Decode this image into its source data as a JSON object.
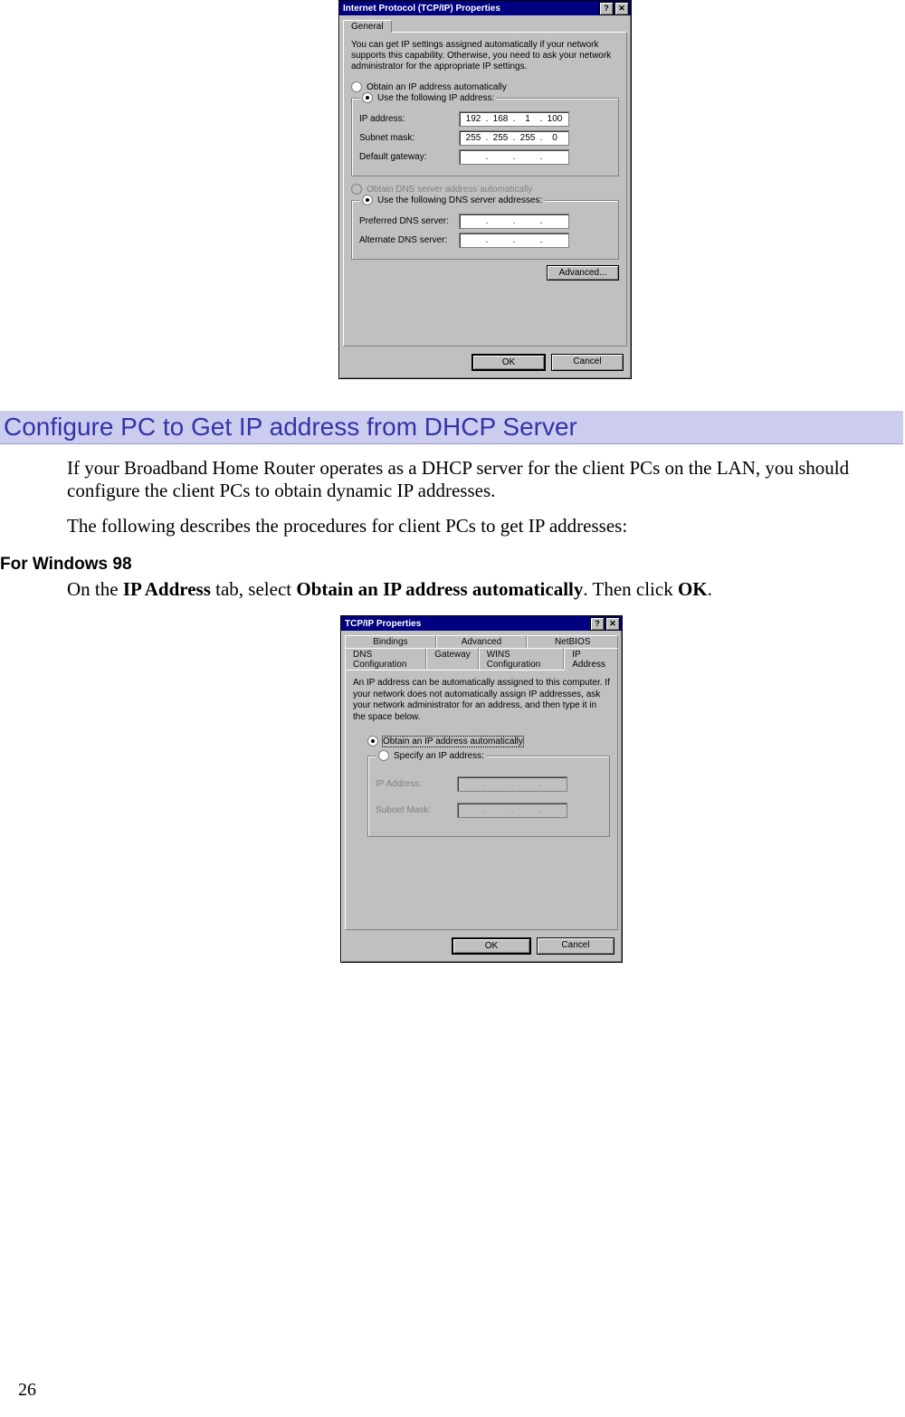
{
  "dialog_ip": {
    "title": "Internet Protocol (TCP/IP) Properties",
    "tab_general": "General",
    "intro": "You can get IP settings assigned automatically if your network supports this capability. Otherwise, you need to ask your network administrator for the appropriate IP settings.",
    "radio_obtain_ip": "Obtain an IP address automatically",
    "radio_use_ip": "Use the following IP address:",
    "lbl_ip": "IP address:",
    "lbl_subnet": "Subnet mask:",
    "lbl_gateway": "Default gateway:",
    "ip_oct": [
      "192",
      "168",
      "1",
      "100"
    ],
    "sm_oct": [
      "255",
      "255",
      "255",
      "0"
    ],
    "gw_oct": [
      "",
      "",
      "",
      ""
    ],
    "radio_obtain_dns": "Obtain DNS server address automatically",
    "radio_use_dns": "Use the following DNS server addresses:",
    "lbl_pref_dns": "Preferred DNS server:",
    "lbl_alt_dns": "Alternate DNS server:",
    "pdns_oct": [
      "",
      "",
      "",
      ""
    ],
    "adns_oct": [
      "",
      "",
      "",
      ""
    ],
    "btn_advanced": "Advanced...",
    "btn_ok": "OK",
    "btn_cancel": "Cancel",
    "help_glyph": "?",
    "close_glyph": "✕"
  },
  "section_heading": "Configure PC to Get IP address from DHCP Server",
  "para1": "If your Broadband Home Router operates as a DHCP server for the client PCs on the LAN, you should configure the client PCs to obtain dynamic IP addresses.",
  "para2": "The following describes the procedures for client PCs to get IP addresses:",
  "win98_heading": "For Windows 98",
  "win98_instr_pre": "On the ",
  "win98_instr_b1": "IP Address",
  "win98_instr_mid1": " tab, select ",
  "win98_instr_b2": "Obtain an IP address automatically",
  "win98_instr_mid2": ". Then click ",
  "win98_instr_b3": "OK",
  "win98_instr_end": ".",
  "dialog_tcpip": {
    "title": "TCP/IP Properties",
    "tabs_back": [
      "Bindings",
      "Advanced",
      "NetBIOS"
    ],
    "tabs_front": [
      "DNS Configuration",
      "Gateway",
      "WINS Configuration",
      "IP Address"
    ],
    "intro": "An IP address can be automatically assigned to this computer. If your network does not automatically assign IP addresses, ask your network administrator for an address, and then type it in the space below.",
    "radio_obtain": "Obtain an IP address automatically",
    "radio_specify": "Specify an IP address:",
    "lbl_ip": "IP Address:",
    "lbl_subnet": "Subnet Mask:",
    "btn_ok": "OK",
    "btn_cancel": "Cancel",
    "help_glyph": "?",
    "close_glyph": "✕"
  },
  "page_number": "26"
}
